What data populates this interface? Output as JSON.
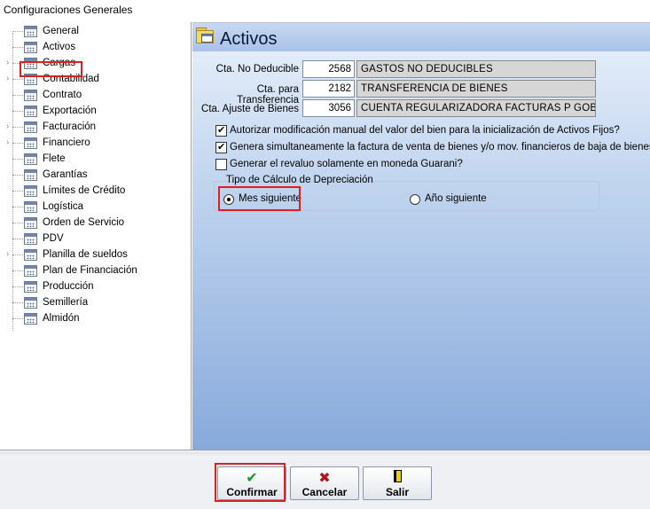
{
  "window": {
    "title": "Configuraciones Generales"
  },
  "tree": {
    "items": [
      {
        "label": "General",
        "expandable": false
      },
      {
        "label": "Activos",
        "expandable": false,
        "selected": true
      },
      {
        "label": "Cargas",
        "expandable": true
      },
      {
        "label": "Contabilidad",
        "expandable": true
      },
      {
        "label": "Contrato",
        "expandable": false
      },
      {
        "label": "Exportación",
        "expandable": false
      },
      {
        "label": "Facturación",
        "expandable": true
      },
      {
        "label": "Financiero",
        "expandable": true
      },
      {
        "label": "Flete",
        "expandable": false
      },
      {
        "label": "Garantías",
        "expandable": false
      },
      {
        "label": "Límites de Crédito",
        "expandable": false
      },
      {
        "label": "Logística",
        "expandable": false
      },
      {
        "label": "Orden de Servicio",
        "expandable": false
      },
      {
        "label": "PDV",
        "expandable": false
      },
      {
        "label": "Planilla de sueldos",
        "expandable": true
      },
      {
        "label": "Plan de Financiación",
        "expandable": false
      },
      {
        "label": "Producción",
        "expandable": false
      },
      {
        "label": "Semillería",
        "expandable": false
      },
      {
        "label": "Almidón",
        "expandable": false
      }
    ]
  },
  "panel": {
    "title": "Activos",
    "accounts": [
      {
        "label": "Cta. No Deducible",
        "code": "2568",
        "description": "GASTOS NO DEDUCIBLES"
      },
      {
        "label": "Cta. para Transferencia",
        "code": "2182",
        "description": "TRANSFERENCIA DE BIENES"
      },
      {
        "label": "Cta. Ajuste de Bienes",
        "code": "3056",
        "description": "CUENTA REGULARIZADORA FACTURAS P GOBIERNO"
      }
    ],
    "options": [
      {
        "label": "Autorizar modificación manual del valor del bien para la inicialización de Activos Fijos?",
        "checked": true
      },
      {
        "label": "Genera simultaneamente la factura de venta de bienes y/o mov. financieros de baja de bienes?",
        "checked": true
      },
      {
        "label": "Generar el revaluo solamente en moneda Guarani?",
        "checked": false
      }
    ],
    "depreciation": {
      "caption": "Tipo de Cálculo de Depreciación",
      "options": [
        {
          "label": "Mes siguiente",
          "selected": true
        },
        {
          "label": "Año siguiente",
          "selected": false
        }
      ]
    }
  },
  "buttons": {
    "confirm": "Confirmar",
    "cancel": "Cancelar",
    "exit": "Salir"
  },
  "colors": {
    "highlight": "#e02020",
    "panel_gradient_top": "#e9f1fb",
    "panel_gradient_bottom": "#88aadb"
  }
}
